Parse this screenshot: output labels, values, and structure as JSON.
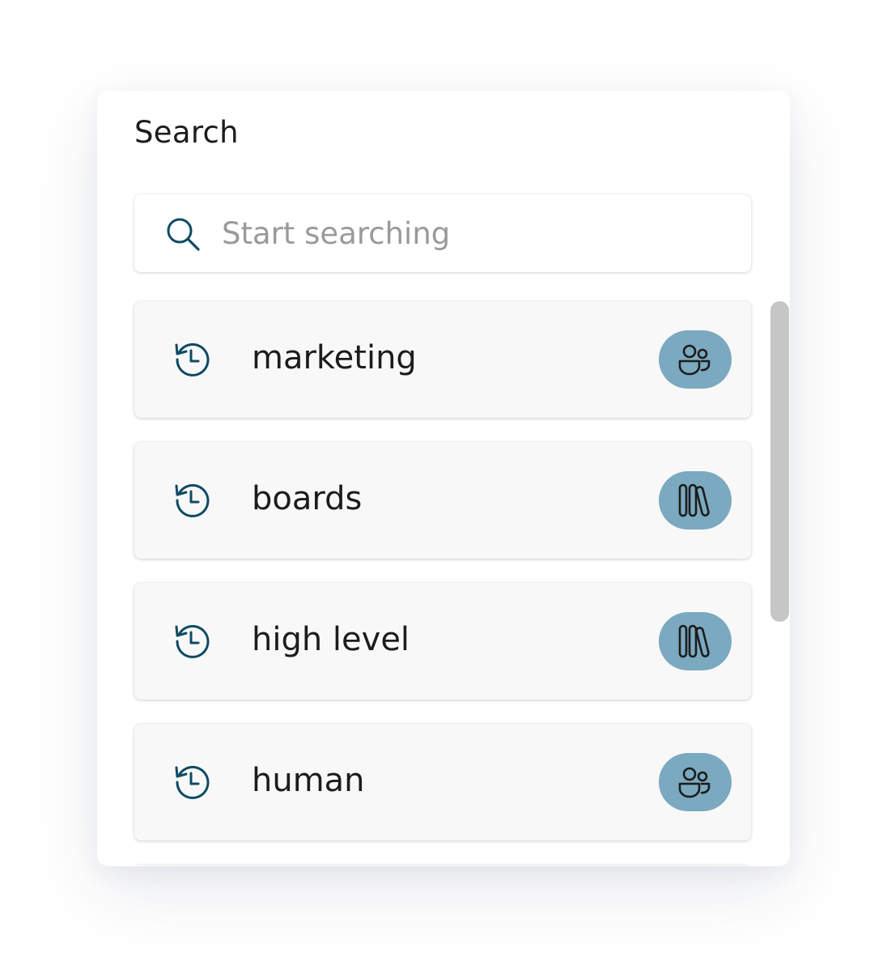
{
  "panel": {
    "title": "Search"
  },
  "search": {
    "placeholder": "Start searching",
    "value": ""
  },
  "items": [
    {
      "label": "marketing",
      "icon": "clock-history-icon",
      "badge_icon": "people-icon"
    },
    {
      "label": "boards",
      "icon": "clock-history-icon",
      "badge_icon": "library-icon"
    },
    {
      "label": "high level",
      "icon": "clock-history-icon",
      "badge_icon": "library-icon"
    },
    {
      "label": "human",
      "icon": "clock-history-icon",
      "badge_icon": "people-icon"
    }
  ],
  "colors": {
    "accent": "#0f4a63",
    "badge_bg": "#7ba9bf",
    "item_bg": "#f8f8f8",
    "scrollbar": "#c6c6c6"
  }
}
